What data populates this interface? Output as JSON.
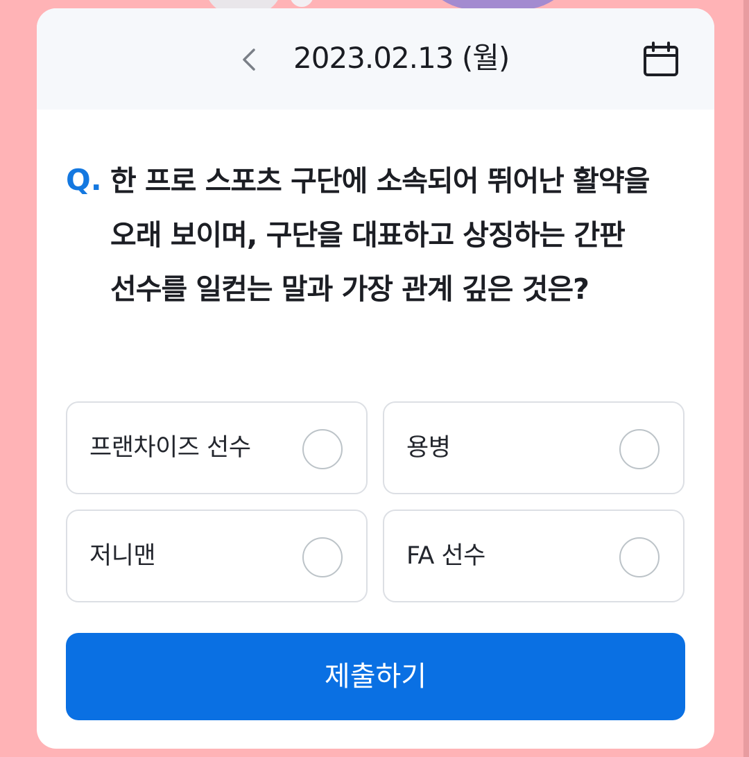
{
  "colors": {
    "page_background": "#ffb3b6",
    "accent": "#0a70e3",
    "question_mark": "#1478e0",
    "header_background": "#f6f8fb"
  },
  "header": {
    "date": "2023.02.13 (월)",
    "back_icon": "chevron-left-icon",
    "calendar_icon": "calendar-icon"
  },
  "question": {
    "prefix": "Q.",
    "text": "한 프로 스포츠 구단에 소속되어 뛰어난 활약을 오래 보이며, 구단을 대표하고 상징하는 간판 선수를 일컫는 말과 가장 관계 깊은 것은?"
  },
  "options": [
    {
      "label": "프랜차이즈 선수",
      "selected": false
    },
    {
      "label": "용병",
      "selected": false
    },
    {
      "label": "저니맨",
      "selected": false
    },
    {
      "label": "FA 선수",
      "selected": false
    }
  ],
  "submit": {
    "label": "제출하기"
  }
}
